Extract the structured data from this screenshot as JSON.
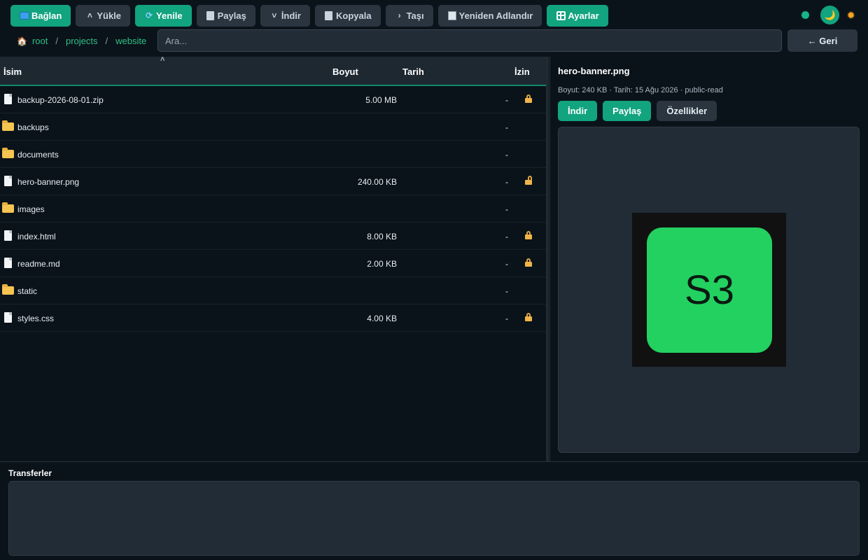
{
  "toolbar": {
    "buttons": [
      {
        "label": "Bağlan",
        "icon": "monitor-icon"
      },
      {
        "label": "Yükle",
        "icon": "chevron-up-icon"
      },
      {
        "label": "Yenile",
        "icon": "refresh-icon"
      },
      {
        "label": "Paylaş",
        "icon": "share-icon"
      },
      {
        "label": "İndir",
        "icon": "chevron-down-icon"
      },
      {
        "label": "Kopyala",
        "icon": "copy-icon"
      },
      {
        "label": "Taşı",
        "icon": "chevron-right-icon"
      },
      {
        "label": "Yeniden Adlandır",
        "icon": "rename-icon"
      },
      {
        "label": "Ayarlar",
        "icon": "grid-icon"
      }
    ],
    "glyphs": {
      "up": "˄",
      "down": "˅",
      "right": "›",
      "refresh": "⟳",
      "moon": "🌙",
      "sun": "✹"
    },
    "status_color": "#17b389",
    "accent_color": "#12a37f"
  },
  "breadcrumb": [
    "root",
    "projects",
    "website"
  ],
  "breadcrumb_sep": "/",
  "breadcrumb_home": "🏠",
  "search": {
    "placeholder": "Ara..."
  },
  "back_button": "← Geri",
  "table": {
    "headers": {
      "name": "İsim",
      "size": "Boyut",
      "date": "Tarih",
      "perm": "İzin"
    },
    "sort_indicator": "˄",
    "rows": [
      {
        "type": "file",
        "name": "backup-2026-08-01.zip",
        "size": "5.00 MB",
        "date": "-",
        "lock": "locked"
      },
      {
        "type": "folder",
        "name": "backups",
        "size": "",
        "date": "-",
        "lock": "none"
      },
      {
        "type": "folder",
        "name": "documents",
        "size": "",
        "date": "-",
        "lock": "none"
      },
      {
        "type": "file",
        "name": "hero-banner.png",
        "size": "240.00 KB",
        "date": "-",
        "lock": "open"
      },
      {
        "type": "folder",
        "name": "images",
        "size": "",
        "date": "-",
        "lock": "none"
      },
      {
        "type": "file",
        "name": "index.html",
        "size": "8.00 KB",
        "date": "-",
        "lock": "locked"
      },
      {
        "type": "file",
        "name": "readme.md",
        "size": "2.00 KB",
        "date": "-",
        "lock": "locked"
      },
      {
        "type": "folder",
        "name": "static",
        "size": "",
        "date": "-",
        "lock": "none"
      },
      {
        "type": "file",
        "name": "styles.css",
        "size": "4.00 KB",
        "date": "-",
        "lock": "locked"
      }
    ]
  },
  "preview": {
    "title": "hero-banner.png",
    "meta": "Boyut: 240 KB · Tarih: 15 Ağu 2026 · public-read",
    "actions": [
      "İndir",
      "Paylaş",
      "Özellikler"
    ],
    "image_text": "S3",
    "image_color": "#23d160"
  },
  "transfers": {
    "title": "Transferler"
  }
}
